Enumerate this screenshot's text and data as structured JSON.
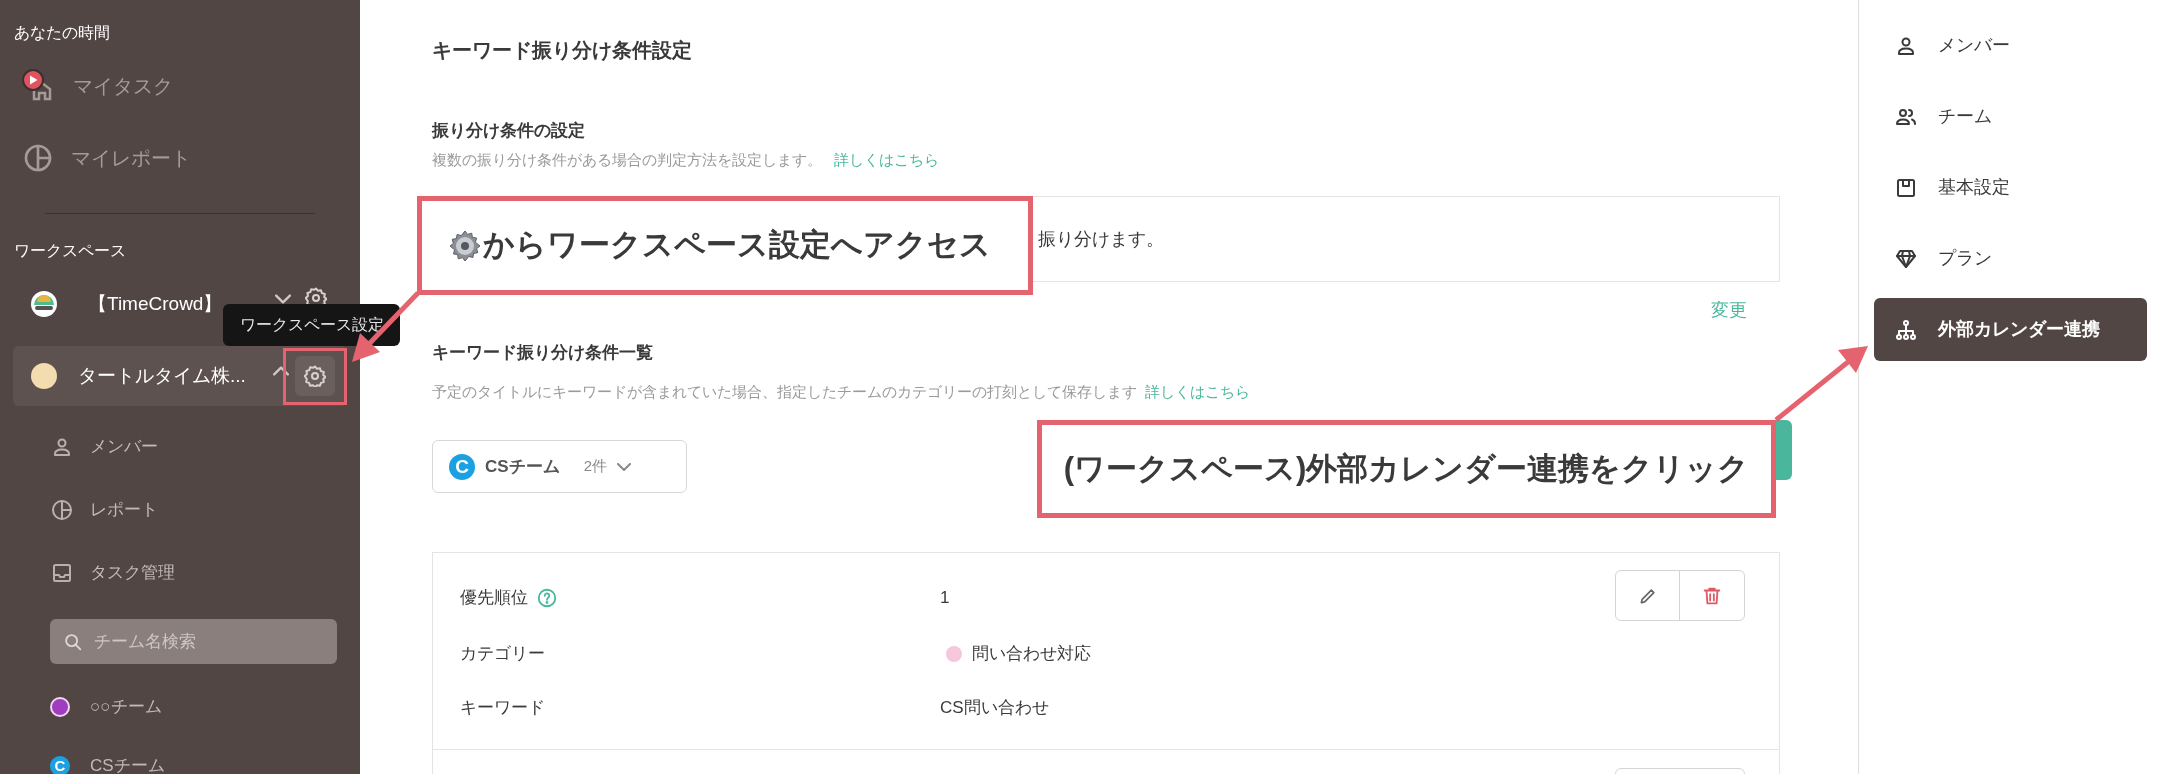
{
  "sidebar": {
    "personal_heading": "あなたの時間",
    "personal_items": [
      {
        "label": "マイタスク"
      },
      {
        "label": "マイレポート"
      }
    ],
    "workspace_heading": "ワークスペース",
    "workspaces": [
      {
        "name": "【TimeCrowd】",
        "selected": false,
        "expanded": false
      },
      {
        "name": "タートルタイム株...",
        "selected": true,
        "expanded": true
      }
    ],
    "workspace_menu": [
      {
        "label": "メンバー"
      },
      {
        "label": "レポート"
      },
      {
        "label": "タスク管理"
      }
    ],
    "team_search": {
      "placeholder": "チーム名検索"
    },
    "teams": [
      {
        "name": "○○チーム",
        "color": "#a23cbf"
      },
      {
        "name": "CSチーム",
        "color": "#1ba1e2",
        "initial": "C"
      }
    ]
  },
  "tooltip": "ワークスペース設定",
  "main": {
    "title": "キーワード振り分け条件設定",
    "distribution": {
      "heading": "振り分け条件の設定",
      "description": "複数の振り分け条件がある場合の判定方法を設定します。",
      "link": "詳しくはこちら",
      "rule_text": "振り分けます。",
      "change_link": "変更"
    },
    "keyword_list": {
      "heading": "キーワード振り分け条件一覧",
      "description": "予定のタイトルにキーワードが含まれていた場合、指定したチームのカテゴリーの打刻として保存します",
      "link": "詳しくはこちら",
      "team_filter": {
        "team": "CSチーム",
        "initial": "C",
        "color": "#1ba1e2",
        "count": "2件"
      },
      "rules": [
        {
          "priority_label": "優先順位",
          "priority": "1",
          "category_label": "カテゴリー",
          "category": "問い合わせ対応",
          "color": "#f6c6da",
          "keyword_label": "キーワード",
          "keyword": "CS問い合わせ"
        }
      ]
    }
  },
  "settings_nav": [
    {
      "label": "メンバー",
      "selected": false
    },
    {
      "label": "チーム",
      "selected": false
    },
    {
      "label": "基本設定",
      "selected": false
    },
    {
      "label": "プラン",
      "selected": false
    },
    {
      "label": "外部カレンダー連携",
      "selected": true
    }
  ],
  "annotations": [
    {
      "text": "からワークスペース設定へアクセス"
    },
    {
      "text": "(ワークスペース)外部カレンダー連携をクリック"
    }
  ]
}
